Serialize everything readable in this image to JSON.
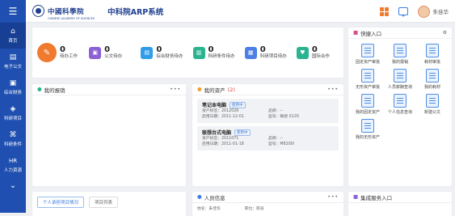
{
  "header": {
    "logo_text": "中國科學院",
    "logo_sub": "CHINESE ACADEMY OF SCIENCES",
    "system_title": "中科院ARP系统",
    "username": "朱佳华",
    "icons": [
      "apps-icon",
      "message-icon",
      "avatar"
    ],
    "colors": {
      "brand": "#1f4fb0",
      "apps": "#f07a2e",
      "message": "#3b7de0"
    }
  },
  "sidebar": {
    "items": [
      {
        "label": "首页",
        "icon": "home-icon"
      },
      {
        "label": "电子公文",
        "icon": "document-icon"
      },
      {
        "label": "综合财务",
        "icon": "finance-icon"
      },
      {
        "label": "科研项目",
        "icon": "project-icon"
      },
      {
        "label": "科研条件",
        "icon": "conditions-icon"
      },
      {
        "label": "人力资源",
        "icon": "hr-icon"
      }
    ],
    "more_icon": "chevron-down-icon"
  },
  "stats": [
    {
      "value": "0",
      "label": "待办工作",
      "color": "#f07a2e"
    },
    {
      "value": "0",
      "label": "公文待办",
      "color": "#8a62d6"
    },
    {
      "value": "0",
      "label": "综合财务待办",
      "color": "#2f9de8"
    },
    {
      "value": "0",
      "label": "科研条件待办",
      "color": "#2bb38f"
    },
    {
      "value": "0",
      "label": "科研项目待办",
      "color": "#4e7fe8"
    },
    {
      "value": "0",
      "label": "国际合作",
      "color": "#2bb38f"
    }
  ],
  "panels": {
    "reimburse": {
      "title": "我的报销",
      "more": "•••"
    },
    "assets": {
      "title": "我的资产",
      "count": "(2)",
      "more": "•••",
      "items": [
        {
          "name": "笔记本电脑",
          "tag": "使用中",
          "asset_no_label": "资产标签：2012026",
          "brand_label": "品牌：--",
          "date_label": "启用日期：2011-12-01",
          "model_label": "型号：联想 X220"
        },
        {
          "name": "联想台式电脑",
          "tag": "使用中",
          "asset_no_label": "资产标签：2011071",
          "brand_label": "品牌：--",
          "date_label": "启用日期：2011-01-18",
          "model_label": "型号：M8200l"
        }
      ]
    },
    "quick": {
      "title": "快捷入口",
      "settings_icon": "gear-icon",
      "items": [
        "固定资产审批",
        "我的报销",
        "耗材审批",
        "无形资产审批",
        "人员薪酬查询",
        "我的耗材",
        "我的固定资产",
        "个人信息查询",
        "新建公文",
        "我的无形资产"
      ]
    },
    "projects": {
      "tabs": [
        "个人承担项目情况",
        "项目列表"
      ]
    },
    "people": {
      "title": "人员信息",
      "more": "•••",
      "row_text": [
        "姓名：朱佳华",
        "职位：职员"
      ]
    },
    "integration": {
      "title": "集成服务入口"
    }
  }
}
